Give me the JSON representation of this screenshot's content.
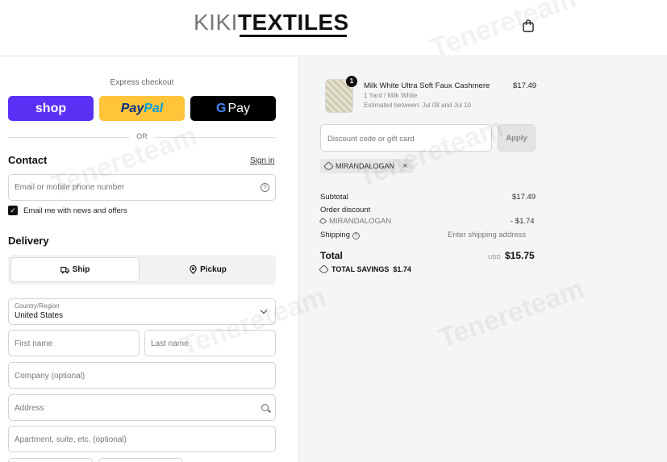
{
  "header": {
    "logo_light": "KIKI",
    "logo_bold": "TEXTILES",
    "cart_icon": "shopping-bag-icon"
  },
  "express": {
    "label": "Express checkout",
    "shop_label": "shop",
    "paypal_part1": "Pay",
    "paypal_part2": "Pal",
    "gpay_g": "G",
    "gpay_label": "Pay",
    "or_label": "OR"
  },
  "contact": {
    "title": "Contact",
    "sign_in": "Sign in",
    "email_placeholder": "Email or mobile phone number",
    "newsletter_label": "Email me with news and offers",
    "newsletter_checked": true
  },
  "delivery": {
    "title": "Delivery",
    "ship_label": "Ship",
    "pickup_label": "Pickup",
    "selected": "Ship",
    "country_label": "Country/Region",
    "country_value": "United States",
    "first_name_placeholder": "First name",
    "last_name_placeholder": "Last name",
    "company_placeholder": "Company (optional)",
    "address_placeholder": "Address",
    "apartment_placeholder": "Apartment, suite, etc. (optional)"
  },
  "order": {
    "product": {
      "name": "Milk White Ultra Soft Faux Cashmere",
      "variant": "1 Yard / Milk White",
      "estimate": "Estimated between: Jul 08 and Jul 10",
      "price": "$17.49",
      "quantity": "1"
    },
    "discount_placeholder": "Discount code or gift card",
    "apply_label": "Apply",
    "applied_code": "MIRANDALOGAN",
    "subtotal_label": "Subtotal",
    "subtotal_value": "$17.49",
    "order_discount_label": "Order discount",
    "discount_code": "MIRANDALOGAN",
    "discount_value": "- $1.74",
    "shipping_label": "Shipping",
    "shipping_value": "Enter shipping address",
    "total_label": "Total",
    "currency": "USD",
    "total_value": "$15.75",
    "savings_label": "TOTAL SAVINGS",
    "savings_value": "$1.74"
  },
  "watermark": "Tenereteam",
  "colors": {
    "shop_purple": "#5a31f4",
    "paypal_yellow": "#ffc439",
    "gpay_black": "#000000",
    "summary_bg": "#f5f5f5"
  }
}
